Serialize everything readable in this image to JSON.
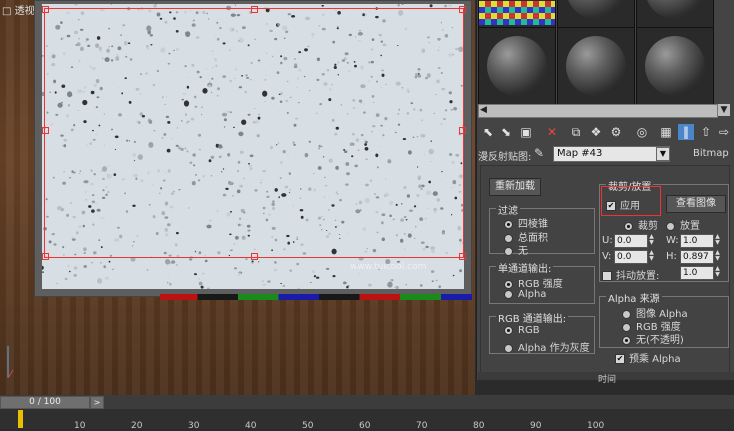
{
  "viewport": {
    "label": "□ 透视",
    "watermark": "www.tuicool.com"
  },
  "material_editor": {
    "map_label": "漫反射贴图:",
    "map_name": "Map #43",
    "map_type": "Bitmap",
    "reload_button": "重新加载",
    "view_image_button": "查看图像",
    "filtering": {
      "title": "过滤",
      "options": [
        "四棱锥",
        "总面积",
        "无"
      ],
      "selected": 0
    },
    "mono_output": {
      "title": "单通道输出:",
      "options": [
        "RGB 强度",
        "Alpha"
      ],
      "selected": 0
    },
    "rgb_output": {
      "title": "RGB 通道输出:",
      "options": [
        "RGB",
        "Alpha 作为灰度"
      ],
      "selected": 0
    },
    "crop": {
      "title": "裁剪/放置",
      "apply_label": "应用",
      "apply_checked": true,
      "mode_options": [
        "裁剪",
        "放置"
      ],
      "mode_selected": 0,
      "u_label": "U:",
      "u_value": "0.0",
      "v_label": "V:",
      "v_value": "0.0",
      "w_label": "W:",
      "w_value": "1.0",
      "h_label": "H:",
      "h_value": "0.897",
      "jitter_label": "抖动放置:",
      "jitter_value": "1.0"
    },
    "alpha_source": {
      "title": "Alpha 来源",
      "options": [
        "图像 Alpha",
        "RGB 强度",
        "无(不透明)"
      ],
      "selected": 2
    },
    "premult_label": "预乘 Alpha",
    "premult_checked": true,
    "time_rollout": "时间"
  },
  "timeline": {
    "frame_display": "0 / 100",
    "next_label": ">",
    "ticks": [
      "10",
      "20",
      "30",
      "40",
      "50",
      "60",
      "70",
      "80",
      "90",
      "100"
    ]
  },
  "colors": {
    "highlight": "#e33333",
    "active_tool": "#4a86c8"
  }
}
